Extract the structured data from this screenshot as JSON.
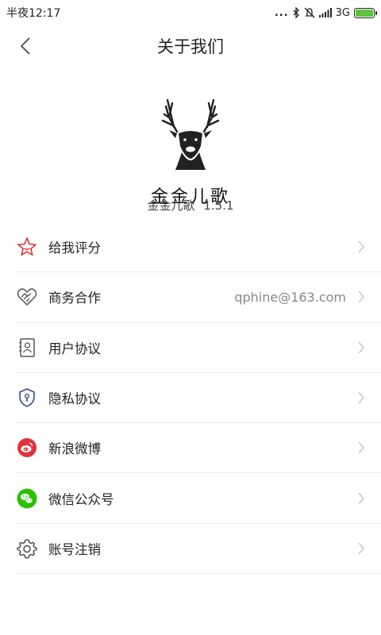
{
  "status": {
    "time": "半夜12:17",
    "network": "3G",
    "dots": "...",
    "battery_level": 1.0
  },
  "header": {
    "title": "关于我们"
  },
  "app": {
    "logo_text": "金金儿歌",
    "name": "金金儿歌",
    "version": "1.5.1"
  },
  "menu": {
    "items": [
      {
        "label": "给我评分",
        "icon": "star-icon",
        "value": ""
      },
      {
        "label": "商务合作",
        "icon": "handshake-icon",
        "value": "qphine@163.com"
      },
      {
        "label": "用户协议",
        "icon": "user-agreement-icon",
        "value": ""
      },
      {
        "label": "隐私协议",
        "icon": "privacy-shield-icon",
        "value": ""
      },
      {
        "label": "新浪微博",
        "icon": "weibo-icon",
        "value": ""
      },
      {
        "label": "微信公众号",
        "icon": "wechat-icon",
        "value": ""
      },
      {
        "label": "账号注销",
        "icon": "gear-icon",
        "value": ""
      }
    ]
  },
  "colors": {
    "star": "#e0323a",
    "weibo": "#e0323a",
    "wechat": "#2dc100",
    "chevron": "#c8c8c8",
    "divider": "#ececec"
  }
}
